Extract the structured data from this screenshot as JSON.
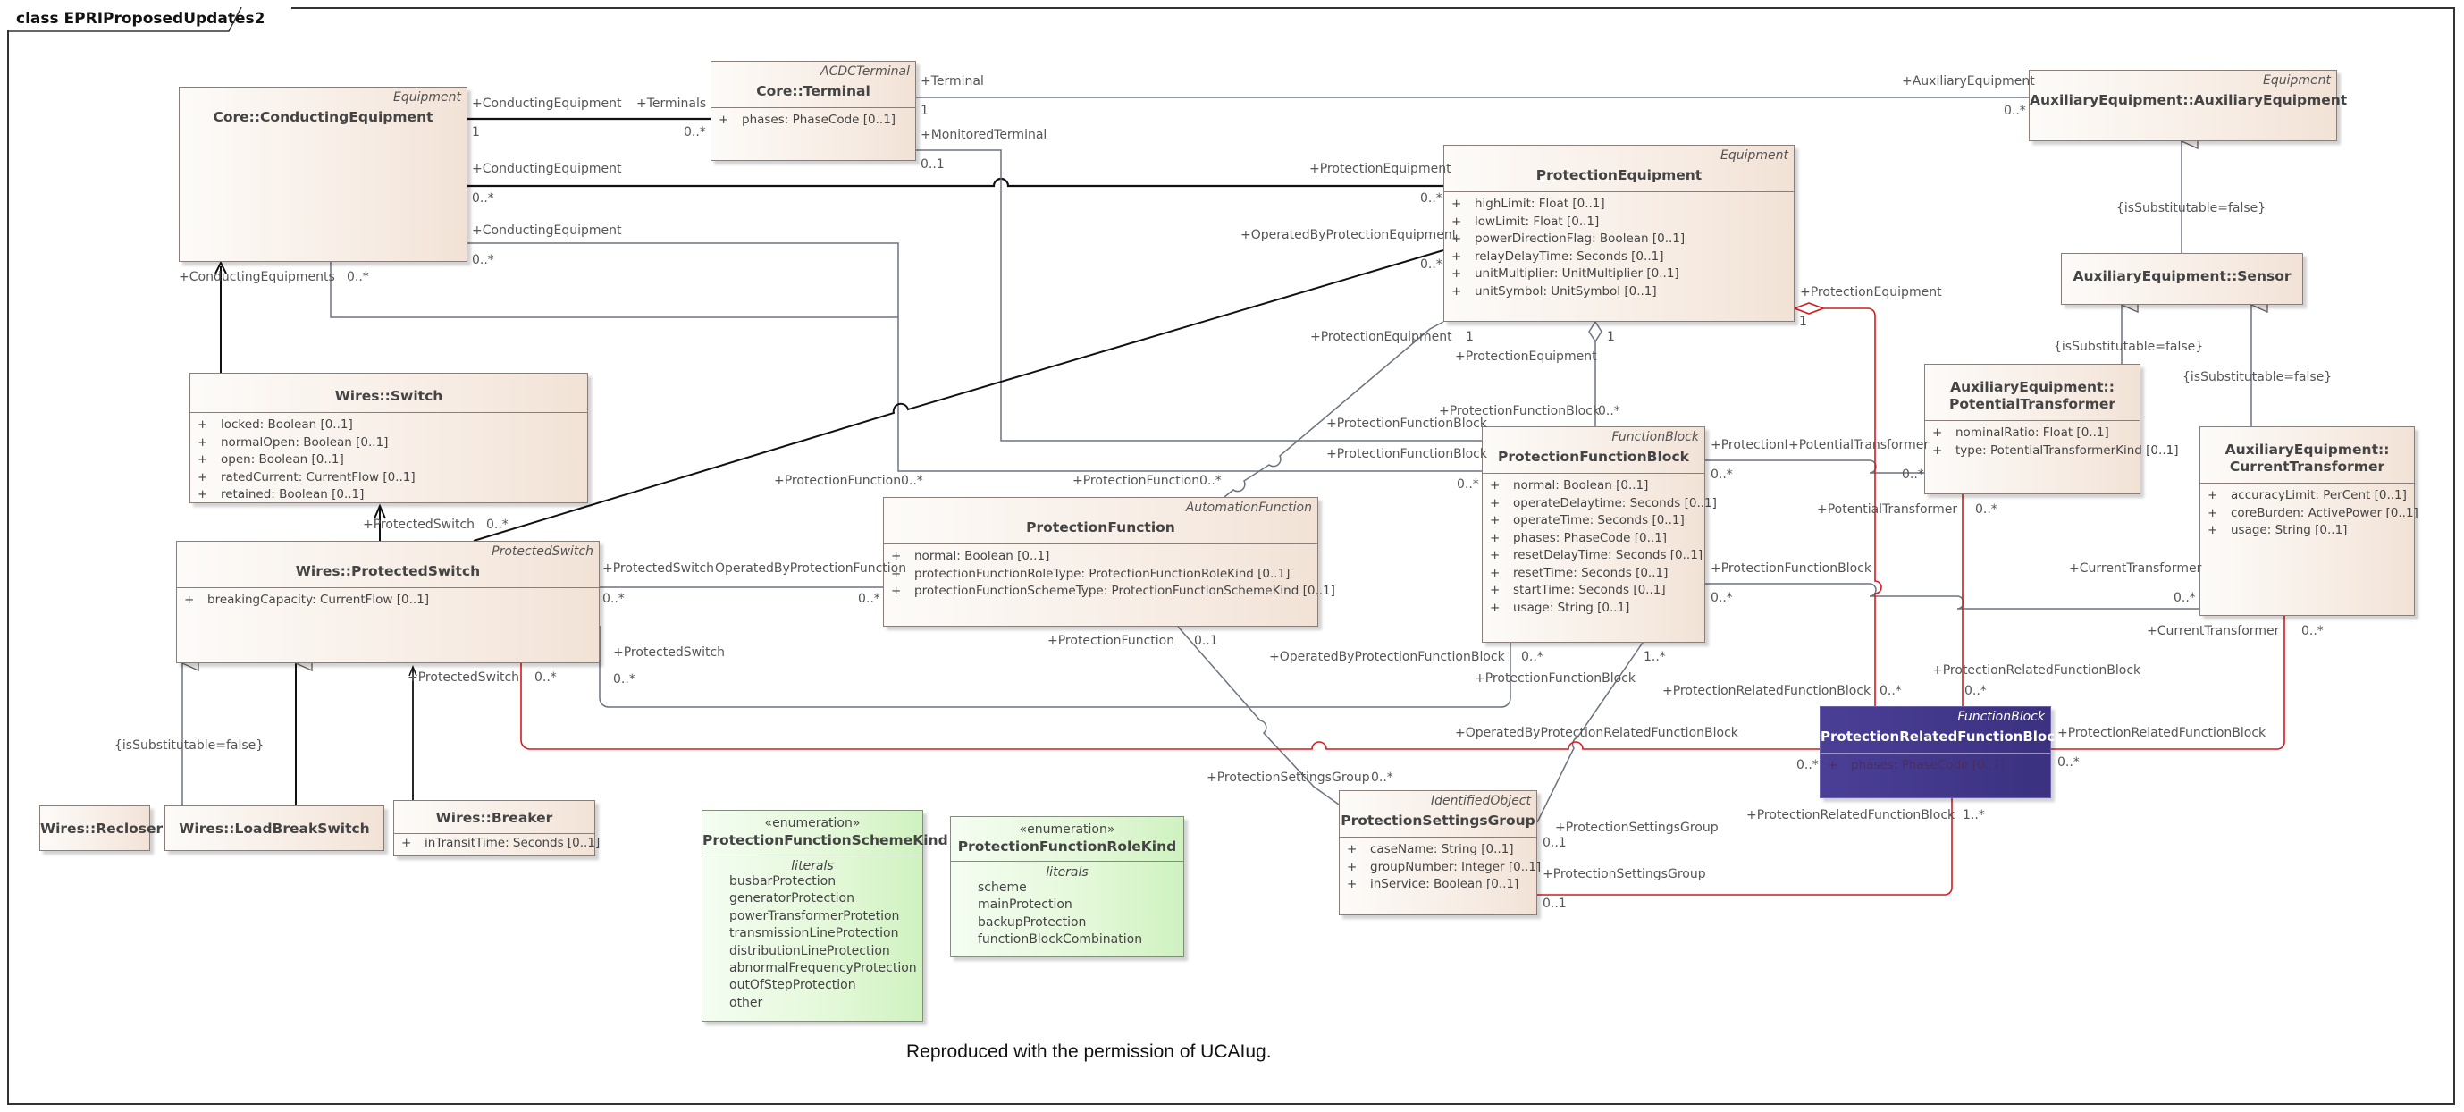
{
  "frame": {
    "title": "class EPRIProposedUpdates2"
  },
  "caption": "Reproduced with the permission of UCAIug.",
  "classes": {
    "conducting_equipment": {
      "stereotype": "Equipment",
      "name": "Core::ConductingEquipment",
      "attributes": []
    },
    "terminal": {
      "stereotype": "ACDCTerminal",
      "name": "Core::Terminal",
      "attributes": [
        "phases: PhaseCode [0..1]"
      ]
    },
    "auxiliary_equipment": {
      "stereotype": "Equipment",
      "name": "AuxiliaryEquipment::AuxiliaryEquipment",
      "attributes": []
    },
    "protection_equipment": {
      "stereotype": "Equipment",
      "name": "ProtectionEquipment",
      "attributes": [
        "highLimit: Float [0..1]",
        "lowLimit: Float [0..1]",
        "powerDirectionFlag: Boolean [0..1]",
        "relayDelayTime: Seconds [0..1]",
        "unitMultiplier: UnitMultiplier [0..1]",
        "unitSymbol: UnitSymbol [0..1]"
      ]
    },
    "sensor": {
      "stereotype": "",
      "name": "AuxiliaryEquipment::Sensor",
      "attributes": []
    },
    "switch": {
      "stereotype": "",
      "name": "Wires::Switch",
      "attributes": [
        "locked: Boolean [0..1]",
        "normalOpen: Boolean [0..1]",
        "open: Boolean [0..1]",
        "ratedCurrent: CurrentFlow [0..1]",
        "retained: Boolean [0..1]"
      ]
    },
    "potential_transformer": {
      "stereotype": "",
      "name_line1": "AuxiliaryEquipment::",
      "name_line2": "PotentialTransformer",
      "attributes": [
        "nominalRatio: Float [0..1]",
        "type: PotentialTransformerKind [0..1]"
      ]
    },
    "current_transformer": {
      "stereotype": "",
      "name_line1": "AuxiliaryEquipment::",
      "name_line2": "CurrentTransformer",
      "attributes": [
        "accuracyLimit: PerCent [0..1]",
        "coreBurden: ActivePower [0..1]",
        "usage: String [0..1]"
      ]
    },
    "protection_function_block": {
      "stereotype": "FunctionBlock",
      "name": "ProtectionFunctionBlock",
      "attributes": [
        "normal: Boolean [0..1]",
        "operateDelaytime: Seconds [0..1]",
        "operateTime: Seconds [0..1]",
        "phases: PhaseCode [0..1]",
        "resetDelayTime: Seconds [0..1]",
        "resetTime: Seconds [0..1]",
        "startTime: Seconds [0..1]",
        "usage: String [0..1]"
      ]
    },
    "protection_function": {
      "stereotype": "AutomationFunction",
      "name": "ProtectionFunction",
      "attributes": [
        "normal: Boolean [0..1]",
        "protectionFunctionRoleType: ProtectionFunctionRoleKind [0..1]",
        "protectionFunctionSchemeType: ProtectionFunctionSchemeKind [0..1]"
      ]
    },
    "protected_switch": {
      "stereotype": "ProtectedSwitch",
      "name": "Wires::ProtectedSwitch",
      "attributes": [
        "breakingCapacity: CurrentFlow [0..1]"
      ]
    },
    "protection_related_function_block": {
      "stereotype": "FunctionBlock",
      "name": "ProtectionRelatedFunctionBlock",
      "attributes": [
        "phases: PhaseCode [0..1]"
      ]
    },
    "protection_settings_group": {
      "stereotype": "IdentifiedObject",
      "name": "ProtectionSettingsGroup",
      "attributes": [
        "caseName: String [0..1]",
        "groupNumber: Integer [0..1]",
        "inService: Boolean [0..1]"
      ]
    },
    "recloser": {
      "name": "Wires::Recloser"
    },
    "load_break_switch": {
      "name": "Wires::LoadBreakSwitch"
    },
    "breaker": {
      "name": "Wires::Breaker",
      "attributes": [
        "inTransitTime: Seconds [0..1]"
      ]
    }
  },
  "enumerations": {
    "scheme_kind": {
      "stereotype": "«enumeration»",
      "name": "ProtectionFunctionSchemeKind",
      "section": "literals",
      "literals": [
        "busbarProtection",
        "generatorProtection",
        "powerTransformerProtetion",
        "transmissionLineProtection",
        "distributionLineProtection",
        "abnormalFrequencyProtection",
        "outOfStepProtection",
        "other"
      ]
    },
    "role_kind": {
      "stereotype": "«enumeration»",
      "name": "ProtectionFunctionRoleKind",
      "section": "literals",
      "literals": [
        "scheme",
        "mainProtection",
        "backupProtection",
        "functionBlockCombination"
      ]
    }
  },
  "attr_visibility": "+",
  "constraint": "{isSubstitutable=false}",
  "edge_colors": {
    "normal": "#6b7280",
    "bold": "#111111",
    "highlight": "#d7191c"
  },
  "labels": [
    "+ConductingEquipment",
    "1",
    "+Terminals",
    "0..*",
    "+ConductingEquipment",
    "0..*",
    "+ConductingEquipment",
    "0..*",
    "+ConductingEquipments",
    "0..*",
    "+Terminal",
    "1",
    "+MonitoredTerminal",
    "0..1",
    "+AuxiliaryEquipment",
    "0..*",
    "+ProtectionEquipment",
    "0..*",
    "+OperatedByProtectionEquipment",
    "0..*",
    "+ProtectionEquipment",
    "1",
    "+ProtectionEquipment",
    "1",
    "+ProtectionEquipment",
    "1",
    "+ProtectionFunctionBlock",
    "0..*",
    "+ProtectionFunctionBlock",
    "+ProtectionFunctionBlock",
    "0..*",
    "+ProtectionFunction",
    "0..*",
    "+ProtectionFunction",
    "0..*",
    "+ProtectedSwitch",
    "0..*",
    "+ProtectedSwitch",
    "OperatedByProtectionFunction",
    "0..*",
    "0..*",
    "+ProtectedSwitch",
    "0..*",
    "+ProtectedSwitch",
    "0..*",
    "+ProtectionI",
    "+PotentialTransformer",
    "0..*",
    "0..*",
    "+PotentialTransformer",
    "0..*",
    "+ProtectionFunctionBlock",
    "0..*",
    "+CurrentTransformer",
    "0..*",
    "+CurrentTransformer",
    "0..*",
    "+ProtectionFunction",
    "0..1",
    "+OperatedByProtectionFunctionBlock",
    "0..*",
    "1..*",
    "+ProtectionFunctionBlock",
    "+ProtectionRelatedFunctionBlock",
    "0..*",
    "+ProtectionRelatedFunctionBlock",
    "0..*",
    "+OperatedByProtectionRelatedFunctionBlock",
    "0..*",
    "+ProtectionRelatedFunctionBlock",
    "0..*",
    "+ProtectionSettingsGroup",
    "0..*",
    "+ProtectionSettingsGroup",
    "0..1",
    "+ProtectionSettingsGroup",
    "0..1",
    "+ProtectionRelatedFunctionBlock",
    "1..*"
  ]
}
